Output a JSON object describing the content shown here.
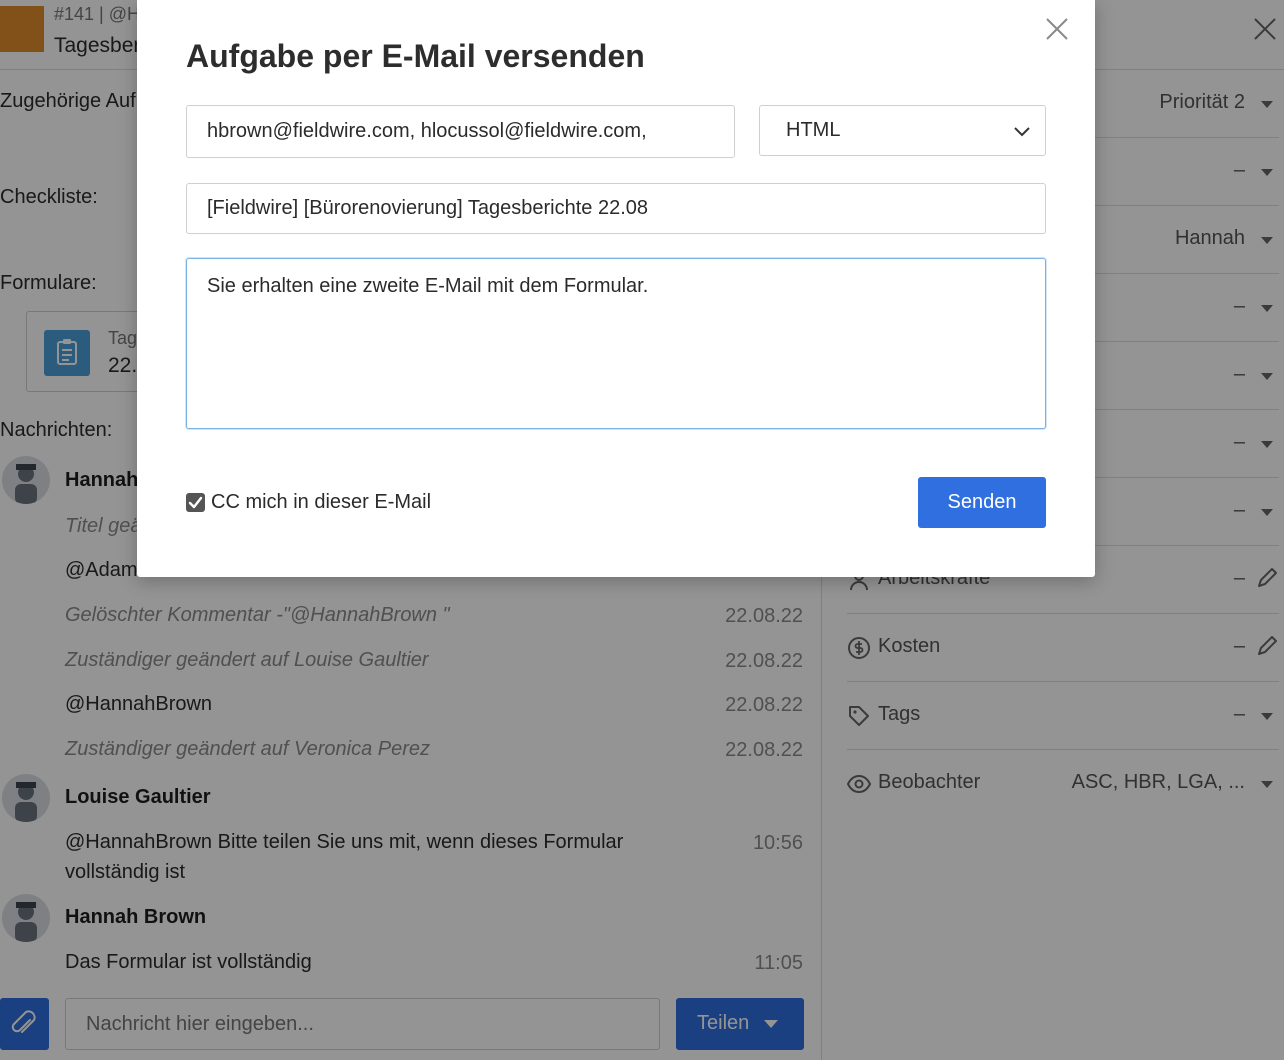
{
  "task": {
    "meta": "#141 | @H",
    "title": "Tagesber",
    "color": "#e08a2c"
  },
  "left": {
    "related_label": "Zugehörige Auf",
    "checklist_label": "Checkliste:",
    "forms_label": "Formulare:",
    "form_card": {
      "name": "Tage",
      "date": "22."
    },
    "messages_label": "Nachrichten:",
    "messages": [
      {
        "author": "Hannah",
        "lines": []
      },
      {
        "text": "Titel geä",
        "system": true,
        "time": ""
      },
      {
        "text": "@AdamS",
        "system": false,
        "time": ""
      },
      {
        "text": "Gelöschter Kommentar -\"@HannahBrown \"",
        "system": true,
        "time": "22.08.22"
      },
      {
        "text": "Zuständiger geändert auf Louise Gaultier",
        "system": true,
        "time": "22.08.22"
      },
      {
        "text": "@HannahBrown",
        "system": false,
        "time": "22.08.22"
      },
      {
        "text": "Zuständiger geändert auf Veronica Perez",
        "system": true,
        "time": "22.08.22"
      },
      {
        "author": "Louise Gaultier"
      },
      {
        "text": "@HannahBrown Bitte teilen Sie uns mit, wenn dieses Formular",
        "text2": "vollständig ist",
        "system": false,
        "time": "10:56"
      },
      {
        "author": "Hannah Brown"
      },
      {
        "text": "Das Formular ist vollständig",
        "system": false,
        "time": "11:05"
      }
    ],
    "composer": {
      "placeholder": "Nachricht hier eingeben...",
      "share_label": "Teilen"
    }
  },
  "right": {
    "rows": [
      {
        "label": "",
        "value": "Priorität 2",
        "icon": "",
        "editable": false
      },
      {
        "label": "",
        "value": "–",
        "icon": "",
        "editable": false
      },
      {
        "label": "",
        "value": "Hannah",
        "icon": "",
        "editable": false
      },
      {
        "label": "",
        "value": "–",
        "icon": "",
        "editable": false
      },
      {
        "label": "",
        "value": "–",
        "icon": "",
        "editable": false
      },
      {
        "label": "",
        "value": "–",
        "icon": "",
        "editable": false
      },
      {
        "label": "",
        "value": "–",
        "icon": "",
        "editable": false
      },
      {
        "label": "Arbeitskräfte",
        "value": "–",
        "icon": "worker-icon",
        "editable": true
      },
      {
        "label": "Kosten",
        "value": "–",
        "icon": "dollar-icon",
        "editable": true
      },
      {
        "label": "Tags",
        "value": "–",
        "icon": "tag-icon",
        "editable": false
      },
      {
        "label": "Beobachter",
        "value": "ASC, HBR, LGA, ...",
        "icon": "eye-icon",
        "editable": false
      }
    ]
  },
  "modal": {
    "title": "Aufgabe per E-Mail versenden",
    "recipients": "hbrown@fieldwire.com, hlocussol@fieldwire.com,",
    "format": "HTML",
    "subject": "[Fieldwire] [Bürorenovierung] Tagesberichte 22.08",
    "body": "Sie erhalten eine zweite E-Mail mit dem Formular.",
    "cc_label": "CC mich in dieser E-Mail",
    "cc_checked": true,
    "send_label": "Senden"
  },
  "colors": {
    "accent": "#2f6fdf",
    "overlay": "rgba(0,0,0,0.42)",
    "focus_border": "#7ab4e6"
  }
}
